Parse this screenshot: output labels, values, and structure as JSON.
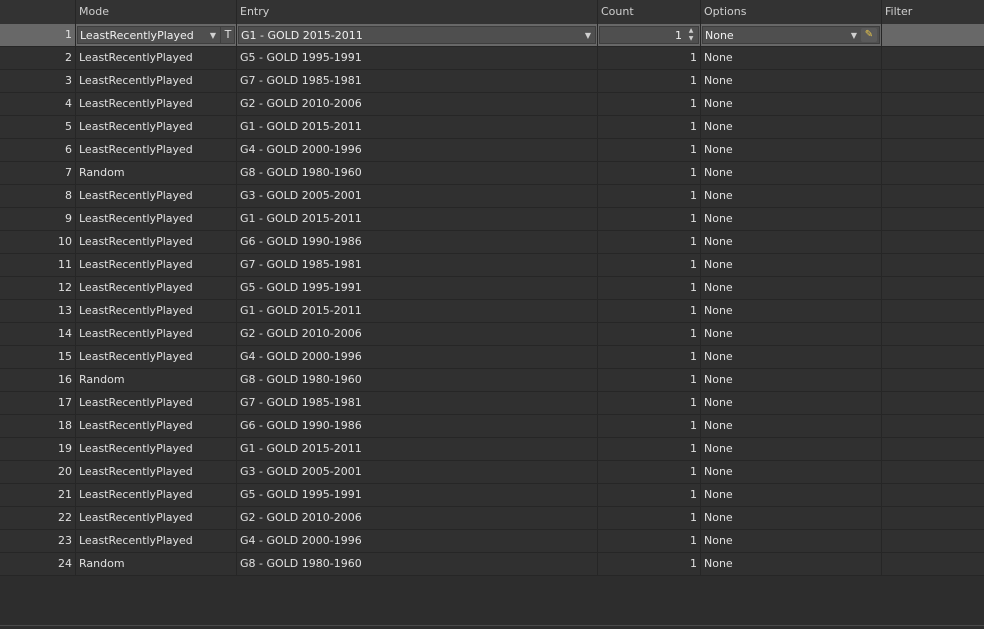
{
  "columns": {
    "index": "",
    "mode": "Mode",
    "entry": "Entry",
    "count": "Count",
    "options": "Options",
    "filter": "Filter"
  },
  "editor": {
    "mode_toggle_label": "T"
  },
  "rows": [
    {
      "index": "1",
      "mode": "LeastRecentlyPlayed",
      "entry": "G1 - GOLD 2015-2011",
      "count": "1",
      "options": "None"
    },
    {
      "index": "2",
      "mode": "LeastRecentlyPlayed",
      "entry": "G5 - GOLD 1995-1991",
      "count": "1",
      "options": "None"
    },
    {
      "index": "3",
      "mode": "LeastRecentlyPlayed",
      "entry": "G7 - GOLD 1985-1981",
      "count": "1",
      "options": "None"
    },
    {
      "index": "4",
      "mode": "LeastRecentlyPlayed",
      "entry": "G2 - GOLD 2010-2006",
      "count": "1",
      "options": "None"
    },
    {
      "index": "5",
      "mode": "LeastRecentlyPlayed",
      "entry": "G1 - GOLD 2015-2011",
      "count": "1",
      "options": "None"
    },
    {
      "index": "6",
      "mode": "LeastRecentlyPlayed",
      "entry": "G4 - GOLD 2000-1996",
      "count": "1",
      "options": "None"
    },
    {
      "index": "7",
      "mode": "Random",
      "entry": "G8 - GOLD 1980-1960",
      "count": "1",
      "options": "None"
    },
    {
      "index": "8",
      "mode": "LeastRecentlyPlayed",
      "entry": "G3 - GOLD 2005-2001",
      "count": "1",
      "options": "None"
    },
    {
      "index": "9",
      "mode": "LeastRecentlyPlayed",
      "entry": "G1 - GOLD 2015-2011",
      "count": "1",
      "options": "None"
    },
    {
      "index": "10",
      "mode": "LeastRecentlyPlayed",
      "entry": "G6 - GOLD 1990-1986",
      "count": "1",
      "options": "None"
    },
    {
      "index": "11",
      "mode": "LeastRecentlyPlayed",
      "entry": "G7 - GOLD 1985-1981",
      "count": "1",
      "options": "None"
    },
    {
      "index": "12",
      "mode": "LeastRecentlyPlayed",
      "entry": "G5 - GOLD 1995-1991",
      "count": "1",
      "options": "None"
    },
    {
      "index": "13",
      "mode": "LeastRecentlyPlayed",
      "entry": "G1 - GOLD 2015-2011",
      "count": "1",
      "options": "None"
    },
    {
      "index": "14",
      "mode": "LeastRecentlyPlayed",
      "entry": "G2 - GOLD 2010-2006",
      "count": "1",
      "options": "None"
    },
    {
      "index": "15",
      "mode": "LeastRecentlyPlayed",
      "entry": "G4 - GOLD 2000-1996",
      "count": "1",
      "options": "None"
    },
    {
      "index": "16",
      "mode": "Random",
      "entry": "G8 - GOLD 1980-1960",
      "count": "1",
      "options": "None"
    },
    {
      "index": "17",
      "mode": "LeastRecentlyPlayed",
      "entry": "G7 - GOLD 1985-1981",
      "count": "1",
      "options": "None"
    },
    {
      "index": "18",
      "mode": "LeastRecentlyPlayed",
      "entry": "G6 - GOLD 1990-1986",
      "count": "1",
      "options": "None"
    },
    {
      "index": "19",
      "mode": "LeastRecentlyPlayed",
      "entry": "G1 - GOLD 2015-2011",
      "count": "1",
      "options": "None"
    },
    {
      "index": "20",
      "mode": "LeastRecentlyPlayed",
      "entry": "G3 - GOLD 2005-2001",
      "count": "1",
      "options": "None"
    },
    {
      "index": "21",
      "mode": "LeastRecentlyPlayed",
      "entry": "G5 - GOLD 1995-1991",
      "count": "1",
      "options": "None"
    },
    {
      "index": "22",
      "mode": "LeastRecentlyPlayed",
      "entry": "G2 - GOLD 2010-2006",
      "count": "1",
      "options": "None"
    },
    {
      "index": "23",
      "mode": "LeastRecentlyPlayed",
      "entry": "G4 - GOLD 2000-1996",
      "count": "1",
      "options": "None"
    },
    {
      "index": "24",
      "mode": "Random",
      "entry": "G8 - GOLD 1980-1960",
      "count": "1",
      "options": "None"
    }
  ],
  "colors": {
    "background": "#2d2d2d",
    "selected_row": "#686868",
    "grid_line": "#262626",
    "edit_icon": "#e8c64a"
  }
}
